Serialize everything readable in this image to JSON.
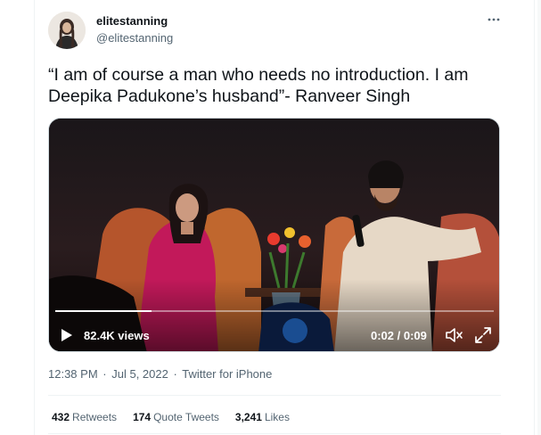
{
  "author": {
    "display_name": "elitestanning",
    "handle": "@elitestanning",
    "avatar_icon": "user-avatar"
  },
  "more_icon": "more-dots-icon",
  "tweet": {
    "text": "“I am of course a man who needs no introduction. I am Deepika Padukone’s husband”- Ranveer Singh"
  },
  "video": {
    "views": "82.4K views",
    "timecode": "0:02 / 0:09",
    "progress": 0.22,
    "play_icon": "play-icon",
    "mute_icon": "mute-icon",
    "expand_icon": "fullscreen-icon"
  },
  "meta": {
    "time": "12:38 PM",
    "separator": "·",
    "date": "Jul 5, 2022",
    "source": "Twitter for iPhone"
  },
  "stats": {
    "retweets_count": "432",
    "retweets_label": "Retweets",
    "quotes_count": "174",
    "quotes_label": "Quote Tweets",
    "likes_count": "3,241",
    "likes_label": "Likes"
  },
  "colors": {
    "text_primary": "#0f1419",
    "text_secondary": "#536471",
    "divider": "#eff3f4"
  }
}
